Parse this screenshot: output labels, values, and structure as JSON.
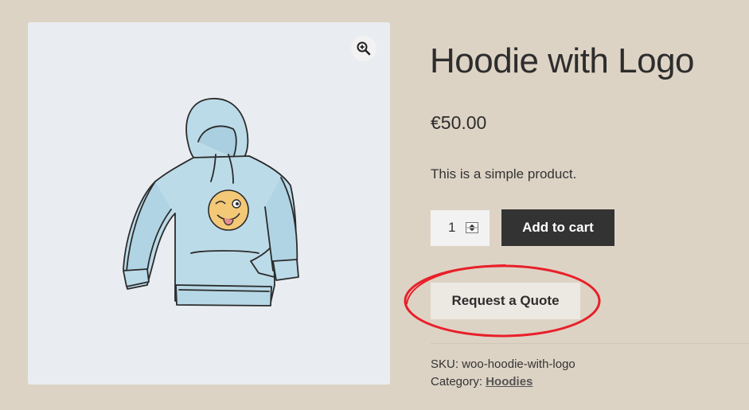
{
  "product": {
    "title": "Hoodie with Logo",
    "price": "€50.00",
    "description": "This is a simple product.",
    "quantity": "1",
    "add_to_cart_label": "Add to cart",
    "request_quote_label": "Request a Quote"
  },
  "meta": {
    "sku_label": "SKU:",
    "sku_value": "woo-hoodie-with-logo",
    "category_label": "Category:",
    "category_value": "Hoodies"
  },
  "icons": {
    "zoom": "zoom-in-icon",
    "product_image": "hoodie-illustration"
  },
  "colors": {
    "page_background": "#ddd3c5",
    "image_background": "#e9edf1",
    "primary_button": "#333333",
    "secondary_button": "#ece8e2",
    "highlight_ellipse": "#e8202a",
    "hoodie_fill": "#bcdbe8",
    "emoji_fill": "#f3c877"
  }
}
